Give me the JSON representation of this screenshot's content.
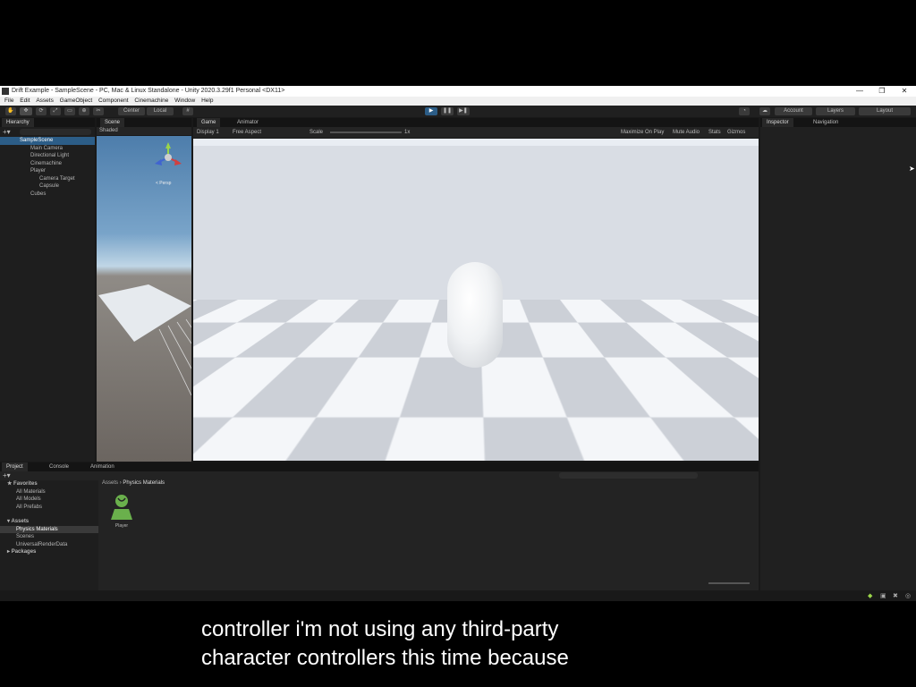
{
  "window": {
    "title": "Drift Example - SampleScene - PC, Mac & Linux Standalone - Unity 2020.3.29f1 Personal <DX11>",
    "controls": [
      "—",
      "❐",
      "✕"
    ]
  },
  "menu": [
    "File",
    "Edit",
    "Assets",
    "GameObject",
    "Component",
    "Cinemachine",
    "Window",
    "Help"
  ],
  "toolbar": {
    "pivot_label": "Center",
    "space_label": "Local",
    "account_label": "Account",
    "layers_label": "Layers",
    "layout_label": "Layout"
  },
  "hierarchy": {
    "tab": "Hierarchy",
    "items": [
      "SampleScene",
      "Main Camera",
      "Directional Light",
      "Cinemachine",
      "Player",
      "Camera Target",
      "Capsule",
      "Cubes"
    ]
  },
  "scene": {
    "tab": "Scene",
    "shading": "Shaded",
    "gizmo_label": "< Persp"
  },
  "game": {
    "tab_game": "Game",
    "tab_animator": "Animator",
    "display": "Display 1",
    "aspect": "Free Aspect",
    "scale_label": "Scale",
    "scale_value": "1x",
    "options": [
      "Maximize On Play",
      "Mute Audio",
      "Stats",
      "Gizmos"
    ]
  },
  "inspector": {
    "tab_inspector": "Inspector",
    "tab_navigation": "Navigation"
  },
  "project": {
    "tabs": [
      "Project",
      "Console",
      "Animation"
    ],
    "favorites_label": "Favorites",
    "favorites": [
      "All Materials",
      "All Models",
      "All Prefabs"
    ],
    "assets_label": "Assets",
    "assets": [
      "Physics Materials",
      "Scenes",
      "UniversalRenderData"
    ],
    "packages_label": "Packages",
    "breadcrumb_root": "Assets",
    "breadcrumb_leaf": "Physics Materials",
    "item": "Player",
    "item_color": "#6ab04c"
  },
  "subtitles": {
    "line1": "controller i'm not using any third-party",
    "line2": "character controllers this time because"
  },
  "colors": {
    "accent": "#2c5d87",
    "editor_bg": "#191919"
  }
}
